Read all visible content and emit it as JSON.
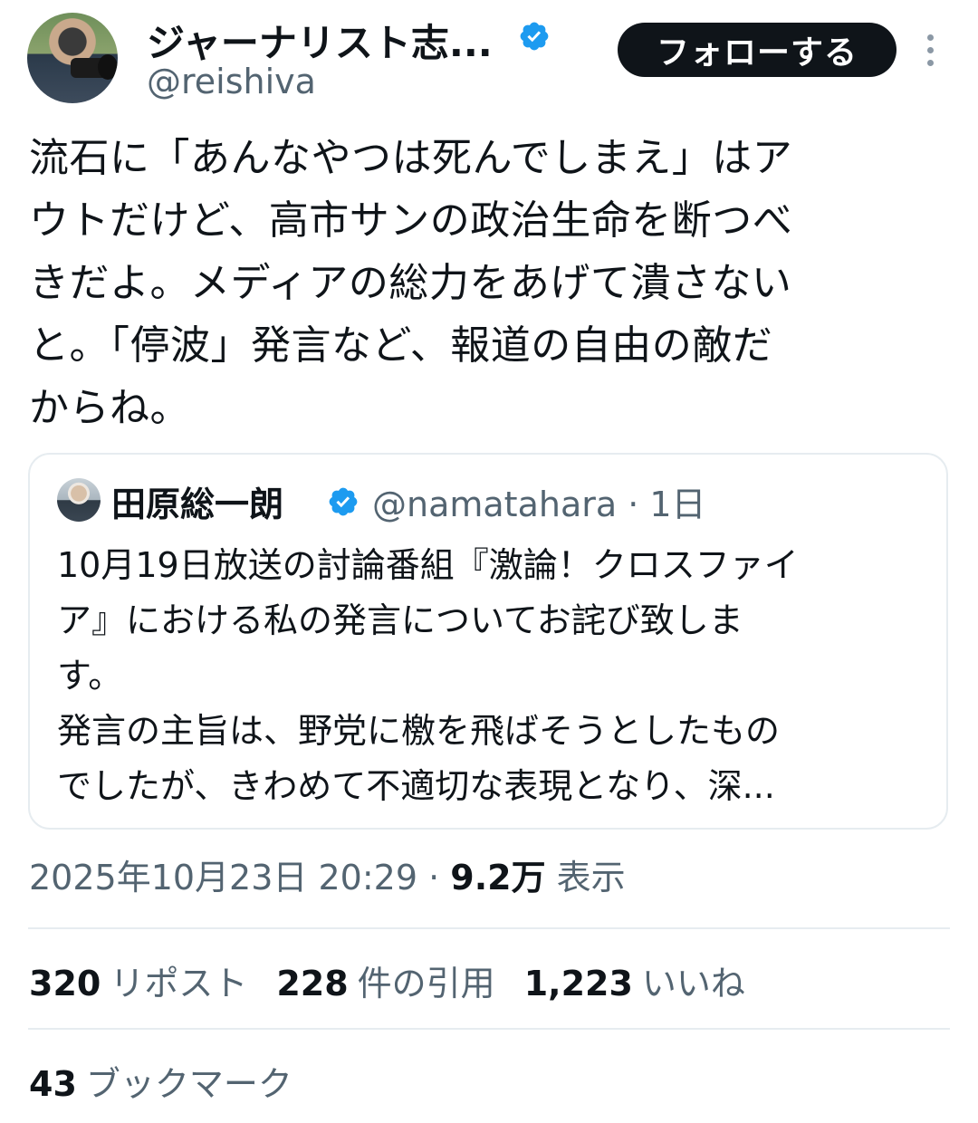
{
  "author": {
    "display_name": "ジャーナリスト志...",
    "handle": "@reishiva",
    "avatar_icon": "profile-photo-camera",
    "verified_icon": "verified-badge-icon",
    "verified_color": "#1d9bf0"
  },
  "follow_button": {
    "label": "フォローする"
  },
  "more_icon": "more-vertical-icon",
  "tweet_text": "流石に「あんなやつは死んでしまえ」はア\nウトだけど、高市サンの政治生命を断つべ\nきだよ。メディアの総力をあげて潰さない\nと。「停波」発言など、報道の自由の敵だ\nからね。",
  "quoted": {
    "display_name": "田原総一朗",
    "handle_time": "@namatahara · 1日",
    "text": "10月19日放送の討論番組『激論！クロスファイ\nア』における私の発言についてお詫び致しま\nす。\n発言の主旨は、野党に檄を飛ばそうとしたもの\nでしたが、きわめて不適切な表現となり、深..."
  },
  "timestamp": {
    "datetime": "2025年10月23日 20:29 · ",
    "views_count": "9.2万",
    "views_label": "表示"
  },
  "stats": {
    "reposts": {
      "count": "320",
      "label": "リポスト"
    },
    "quotes": {
      "count": "228",
      "label": "件の引用"
    },
    "likes": {
      "count": "1,223",
      "label": "いいね"
    },
    "bookmarks": {
      "count": "43",
      "label": "ブックマーク"
    }
  }
}
